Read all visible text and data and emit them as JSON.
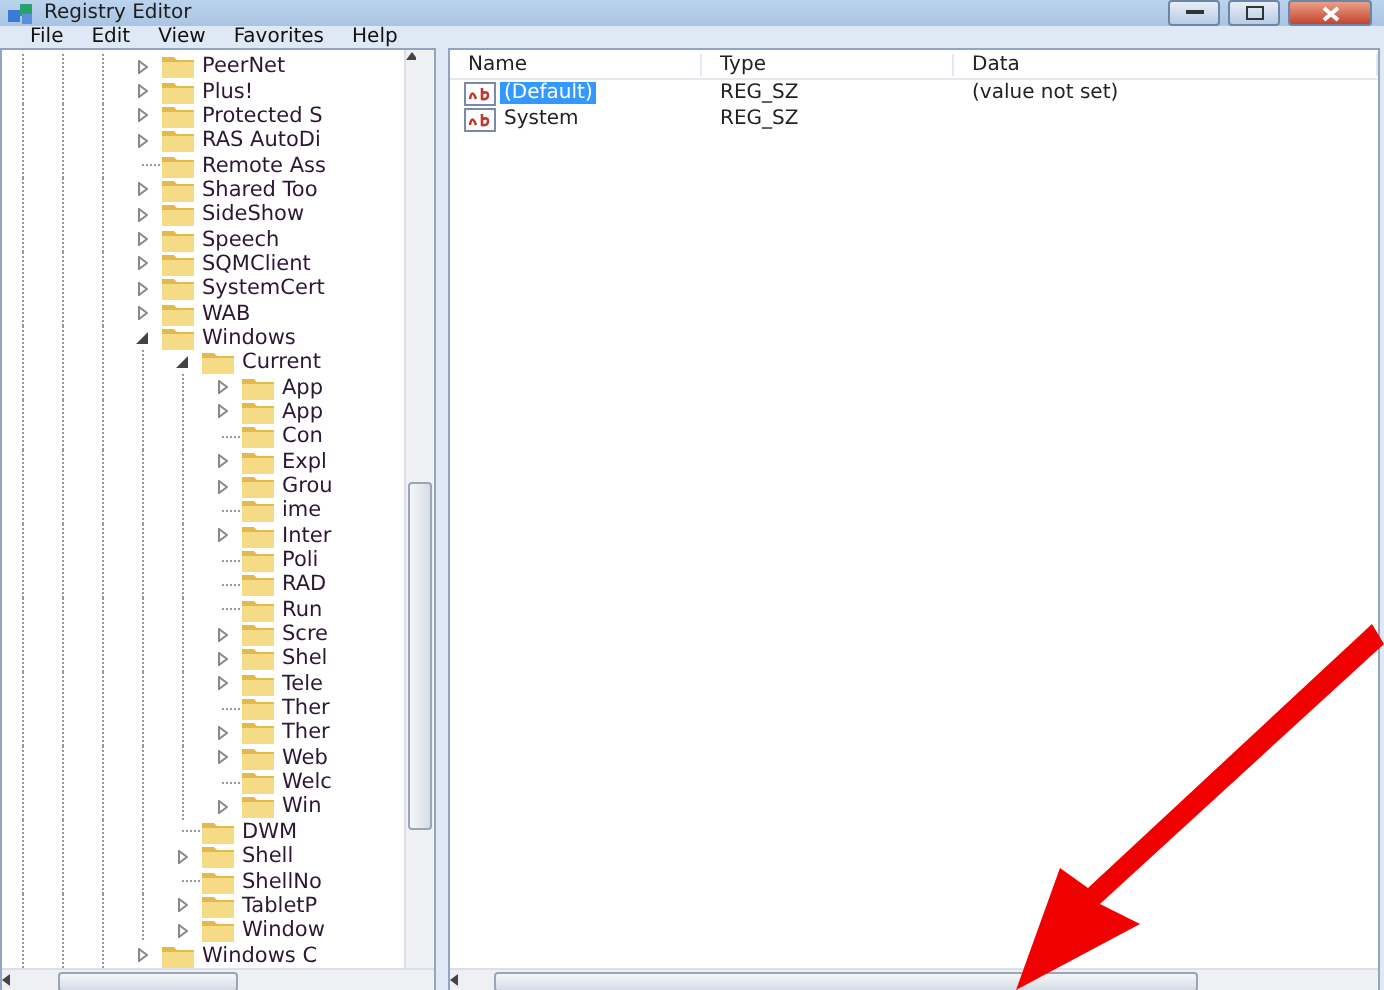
{
  "window": {
    "title": "Registry Editor"
  },
  "menu": [
    "File",
    "Edit",
    "View",
    "Favorites",
    "Help"
  ],
  "tree": [
    {
      "label": "PeerNet",
      "expandable": true,
      "expanded": false
    },
    {
      "label": "Plus!",
      "expandable": true,
      "expanded": false
    },
    {
      "label": "Protected S",
      "expandable": true,
      "expanded": false
    },
    {
      "label": "RAS AutoDi",
      "expandable": true,
      "expanded": false
    },
    {
      "label": "Remote Ass",
      "expandable": false
    },
    {
      "label": "Shared Too",
      "expandable": true,
      "expanded": false
    },
    {
      "label": "SideShow",
      "expandable": true,
      "expanded": false
    },
    {
      "label": "Speech",
      "expandable": true,
      "expanded": false
    },
    {
      "label": "SQMClient",
      "expandable": true,
      "expanded": false
    },
    {
      "label": "SystemCert",
      "expandable": true,
      "expanded": false
    },
    {
      "label": "WAB",
      "expandable": true,
      "expanded": false
    },
    {
      "label": "Windows",
      "expandable": true,
      "expanded": true,
      "children": [
        {
          "label": "Current",
          "expandable": true,
          "expanded": true,
          "children": [
            {
              "label": "App",
              "expandable": true,
              "expanded": false
            },
            {
              "label": "App",
              "expandable": true,
              "expanded": false
            },
            {
              "label": "Con",
              "expandable": false
            },
            {
              "label": "Expl",
              "expandable": true,
              "expanded": false
            },
            {
              "label": "Grou",
              "expandable": true,
              "expanded": false
            },
            {
              "label": "ime",
              "expandable": false
            },
            {
              "label": "Inter",
              "expandable": true,
              "expanded": false
            },
            {
              "label": "Poli",
              "expandable": false
            },
            {
              "label": "RAD",
              "expandable": false
            },
            {
              "label": "Run",
              "expandable": false
            },
            {
              "label": "Scre",
              "expandable": true,
              "expanded": false
            },
            {
              "label": "Shel",
              "expandable": true,
              "expanded": false
            },
            {
              "label": "Tele",
              "expandable": true,
              "expanded": false
            },
            {
              "label": "Ther",
              "expandable": false
            },
            {
              "label": "Ther",
              "expandable": true,
              "expanded": false
            },
            {
              "label": "Web",
              "expandable": true,
              "expanded": false
            },
            {
              "label": "Welc",
              "expandable": false
            },
            {
              "label": "Win",
              "expandable": true,
              "expanded": false
            }
          ]
        },
        {
          "label": "DWM",
          "expandable": false
        },
        {
          "label": "Shell",
          "expandable": true,
          "expanded": false
        },
        {
          "label": "ShellNo",
          "expandable": false
        },
        {
          "label": "TabletP",
          "expandable": true,
          "expanded": false
        },
        {
          "label": "Window",
          "expandable": true,
          "expanded": false
        }
      ]
    },
    {
      "label": "Windows C",
      "expandable": true,
      "expanded": false
    }
  ],
  "values": {
    "columns": [
      "Name",
      "Type",
      "Data"
    ],
    "rows": [
      {
        "name": "(Default)",
        "type": "REG_SZ",
        "data": "(value not set)",
        "selected": true
      },
      {
        "name": "System",
        "type": "REG_SZ",
        "data": "",
        "selected": false
      }
    ]
  }
}
